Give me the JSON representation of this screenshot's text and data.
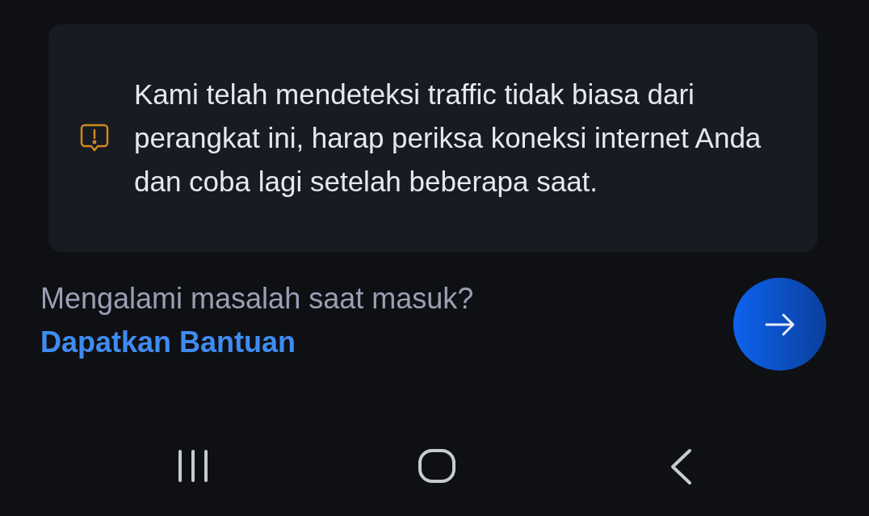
{
  "toast": {
    "message": "Kami telah mendeteksi traffic tidak biasa dari perangkat ini, harap periksa koneksi internet Anda dan coba lagi setelah beberapa saat."
  },
  "help": {
    "question": "Mengalami masalah saat masuk?",
    "link": "Dapatkan Bantuan"
  }
}
